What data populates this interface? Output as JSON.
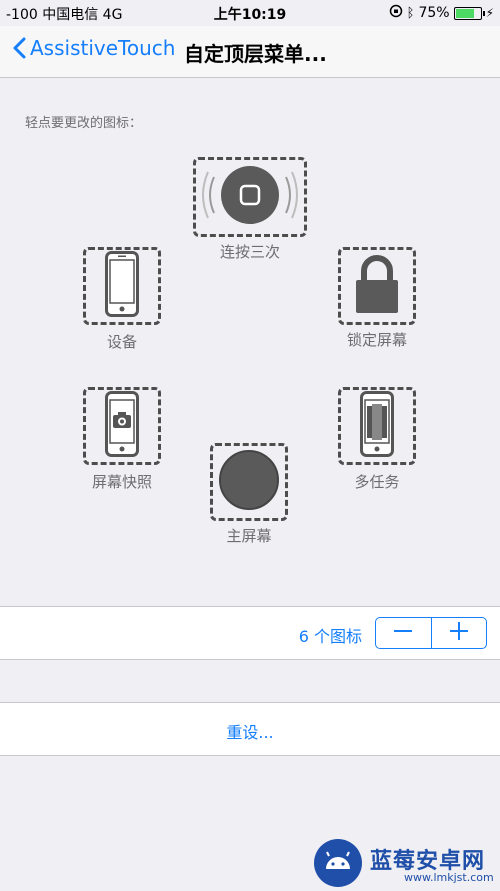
{
  "status_bar": {
    "carrier": "-100 中国电信  4G",
    "time": "上午10:19",
    "battery": "75%",
    "battery_level": 0.75
  },
  "nav": {
    "back_label": "AssistiveTouch",
    "title": "自定顶层菜单..."
  },
  "hint": "轻点要更改的图标：",
  "icons": {
    "top": "连按三次",
    "left_top": "设备",
    "right_top": "锁定屏幕",
    "left_bottom": "屏幕快照",
    "right_bottom": "多任务",
    "bottom": "主屏幕"
  },
  "icon_count": {
    "label": "6 个图标",
    "minus": "−",
    "plus": "+"
  },
  "reset_label": "重设...",
  "watermark": {
    "title": "蓝莓安卓网",
    "url": "www.lmkjst.com"
  },
  "colors": {
    "accent": "#147efb",
    "background": "#efeff4"
  }
}
